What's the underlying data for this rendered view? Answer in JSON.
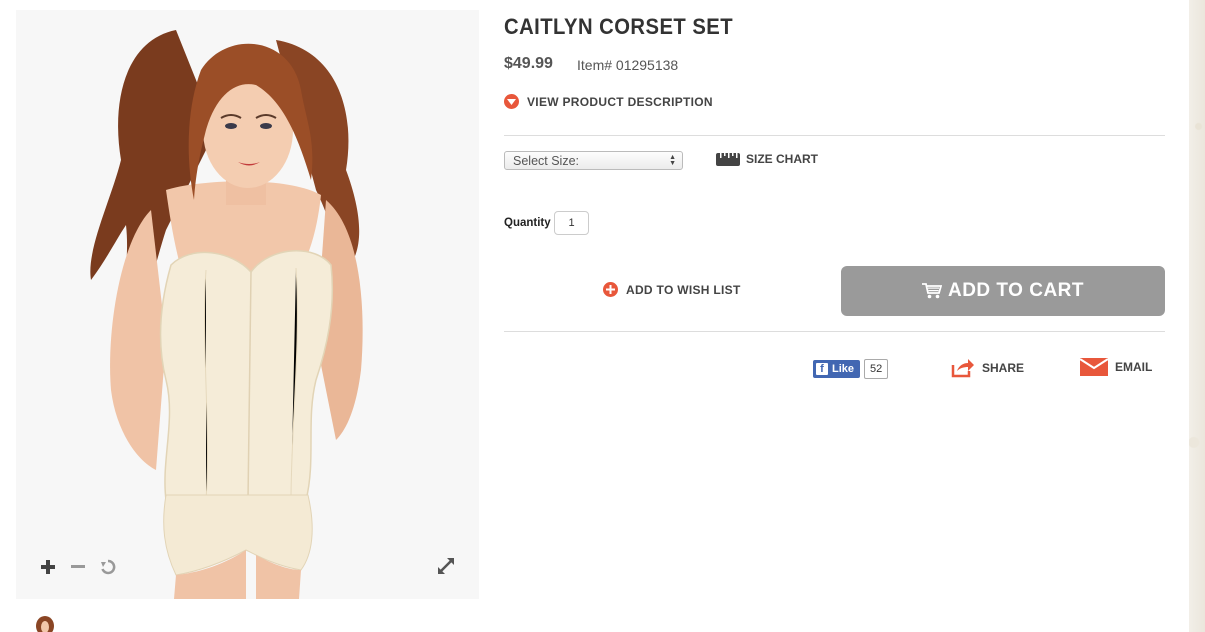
{
  "product": {
    "title": "CAITLYN CORSET SET",
    "price": "$49.99",
    "item_number": "Item# 01295138",
    "view_description_label": "VIEW PRODUCT DESCRIPTION"
  },
  "size": {
    "select_placeholder": "Select Size:",
    "size_chart_label": "SIZE CHART"
  },
  "quantity": {
    "label": "Quantity",
    "value": "1"
  },
  "actions": {
    "wish_list_label": "ADD TO WISH LIST",
    "add_to_cart_label": "ADD TO CART"
  },
  "social": {
    "like_label": "Like",
    "like_count": "52",
    "share_label": "SHARE",
    "email_label": "EMAIL"
  },
  "image_controls": {
    "icons": [
      "zoom-in-icon",
      "zoom-out-icon",
      "reset-icon",
      "fullscreen-icon"
    ]
  },
  "colors": {
    "accent": "#e8573b",
    "cart_button": "#9a9a9a",
    "facebook": "#4267b2"
  }
}
